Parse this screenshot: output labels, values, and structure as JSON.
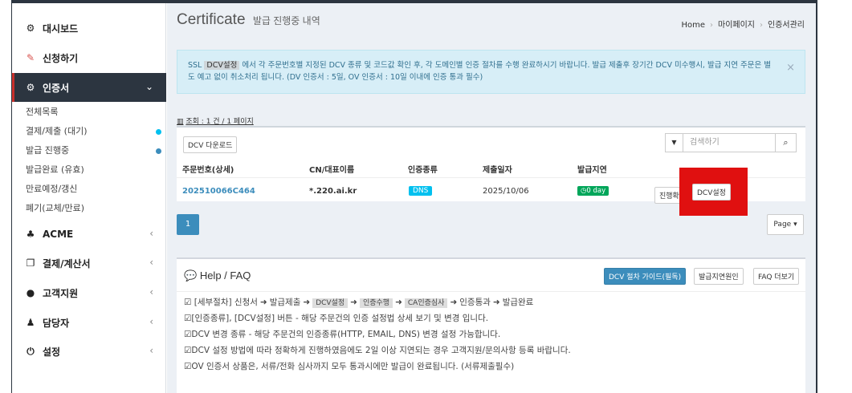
{
  "sidebar": {
    "items": [
      {
        "icon": "dashboard-icon",
        "glyph": "⚙",
        "label": "대시보드"
      },
      {
        "icon": "edit-icon",
        "glyph": "✎",
        "label": "신청하기"
      },
      {
        "icon": "cogs-icon",
        "glyph": "⚙",
        "label": "인증서"
      },
      {
        "icon": "sitemap-icon",
        "glyph": "♣",
        "label": "ACME"
      },
      {
        "icon": "copy-icon",
        "glyph": "❐",
        "label": "결제/계산서"
      },
      {
        "icon": "comments-icon",
        "glyph": "●",
        "label": "고객지원"
      },
      {
        "icon": "users-icon",
        "glyph": "♟",
        "label": "담당자"
      },
      {
        "icon": "power-icon",
        "glyph": "⏻",
        "label": "설정"
      }
    ],
    "sub_items": [
      {
        "label": "전체목록"
      },
      {
        "label": "결제/제출 (대기)",
        "dot": "#00c0ef"
      },
      {
        "label": "발급 진행중",
        "dot": "#3c8dbc"
      },
      {
        "label": "발급완료 (유효)"
      },
      {
        "label": "만료예정/갱신"
      },
      {
        "label": "폐기(교체/만료)"
      }
    ]
  },
  "header": {
    "title": "Certificate",
    "subtitle": "발급 진행중 내역",
    "breadcrumb": [
      "Home",
      "마이페이지",
      "인증서관리"
    ]
  },
  "alert": {
    "prefix": "SSL",
    "tag": "DCV설정",
    "text": "에서 각 주문번호별 지정된 DCV 종류 및 코드값 확인 후, 각 도메인별 인증 절차를 수행 완료하시기 바랍니다. 발급 제출후 장기간 DCV 미수행시, 발급 지연 주문은 별도 예고 없이 취소처리 됩니다. (DV 인증서 : 5일, OV 인증서 : 10일 이내에 인증 통과 필수)",
    "close": "×"
  },
  "list": {
    "count": "조회 : 1 건 / 1 페이지",
    "download_label": "DCV 다운로드",
    "search_placeholder": "검색하기",
    "headers": [
      "주문번호(상세)",
      "CN/대표이름",
      "인증종류",
      "제출일자",
      "발급지연"
    ],
    "row": {
      "order": "202510066C464",
      "cn": "*.220.ai.kr",
      "type": "DNS",
      "date": "2025/10/06",
      "delay": "0 day",
      "progress_label": "진행확",
      "dcv_label": "DCV설정"
    }
  },
  "pager": {
    "current": "1",
    "page_label": "Page"
  },
  "faq": {
    "title": "Help / FAQ",
    "buttons": [
      "DCV 절차 가이드(필독)",
      "발급지연원인",
      "FAQ 더보기"
    ],
    "line1": [
      "[세부절차] 신청서",
      "발급제출",
      "DCV설정",
      "인증수행",
      "CA인증심사",
      "인증통과",
      "발급완료"
    ],
    "line2": "[인증종류], [DCV설정] 버튼 - 해당 주문건의 인증 설정법 상세 보기 및 변경 입니다.",
    "line3": "DCV 변경 종류 - 해당 주문건의 인증종류(HTTP, EMAIL, DNS) 변경 설정 가능합니다.",
    "line4": "DCV 설정 방법에 따라 정확하게 진행하였음에도 2일 이상 지연되는 경우 고객지원/문의사항 등록 바랍니다.",
    "line5": "OV 인증서 상품은, 서류/전화 심사까지 모두 통과시에만 발급이 완료됩니다. (서류제출필수)"
  },
  "colors": {
    "highlight": "#e01010",
    "primary": "#3c8dbc",
    "success": "#00a65a",
    "info": "#00c0ef"
  }
}
